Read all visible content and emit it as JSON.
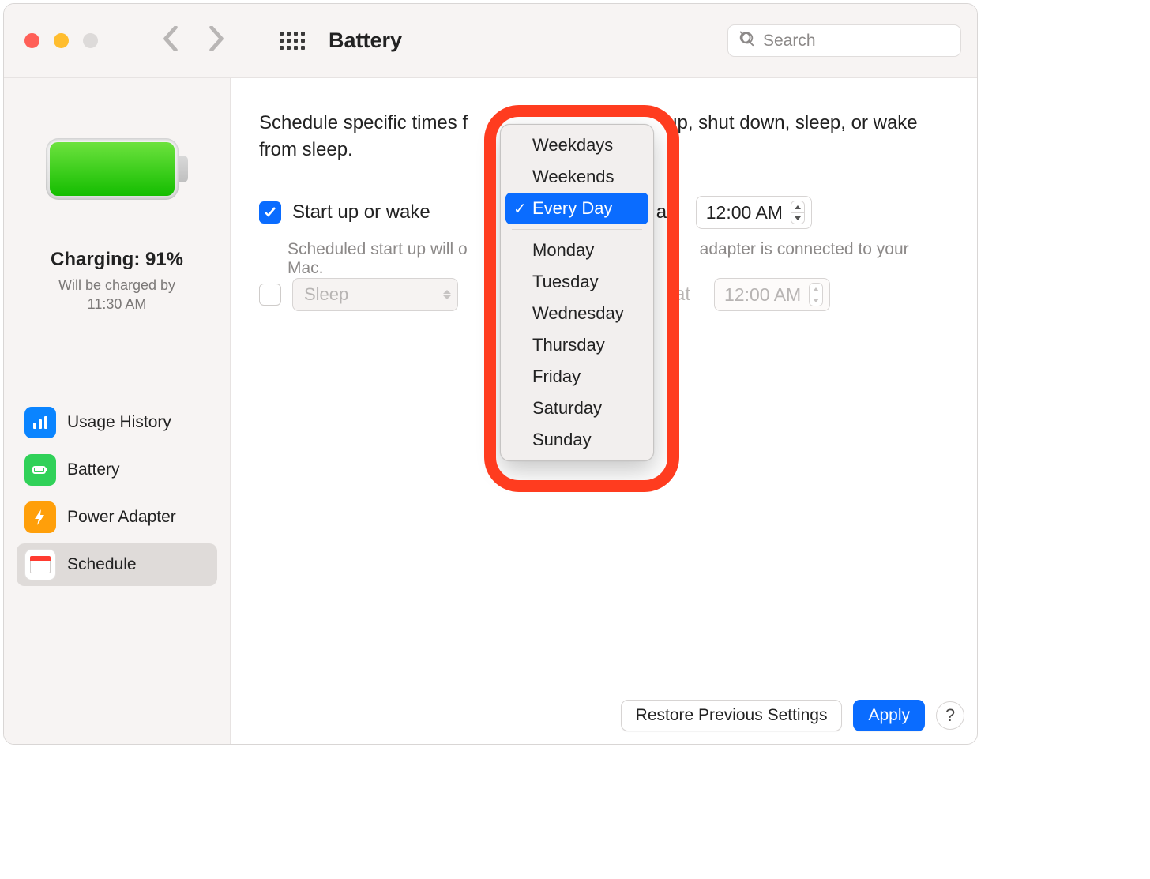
{
  "window": {
    "title": "Battery"
  },
  "search": {
    "placeholder": "Search"
  },
  "sidebar": {
    "charge_label": "Charging: 91%",
    "charge_sub_line1": "Will be charged by",
    "charge_sub_line2": "11:30 AM",
    "items": [
      {
        "id": "usage-history",
        "label": "Usage History"
      },
      {
        "id": "battery",
        "label": "Battery"
      },
      {
        "id": "power-adapter",
        "label": "Power Adapter"
      },
      {
        "id": "schedule",
        "label": "Schedule",
        "active": true
      }
    ]
  },
  "main": {
    "intro_prefix": "Schedule specific times f",
    "intro_suffix": "up, shut down, sleep, or wake from sleep.",
    "row1": {
      "checked": true,
      "label": "Start up or wake",
      "at": "at",
      "time": "12:00 AM",
      "note": "Scheduled start up will o",
      "note_suffix": "adapter is connected to your Mac."
    },
    "row2": {
      "checked": false,
      "select_label": "Sleep",
      "at": "at",
      "time": "12:00 AM"
    }
  },
  "menu": {
    "groups": [
      [
        "Weekdays",
        "Weekends",
        "Every Day"
      ],
      [
        "Monday",
        "Tuesday",
        "Wednesday",
        "Thursday",
        "Friday",
        "Saturday",
        "Sunday"
      ]
    ],
    "selected": "Every Day"
  },
  "footer": {
    "restore": "Restore Previous Settings",
    "apply": "Apply",
    "help": "?"
  }
}
